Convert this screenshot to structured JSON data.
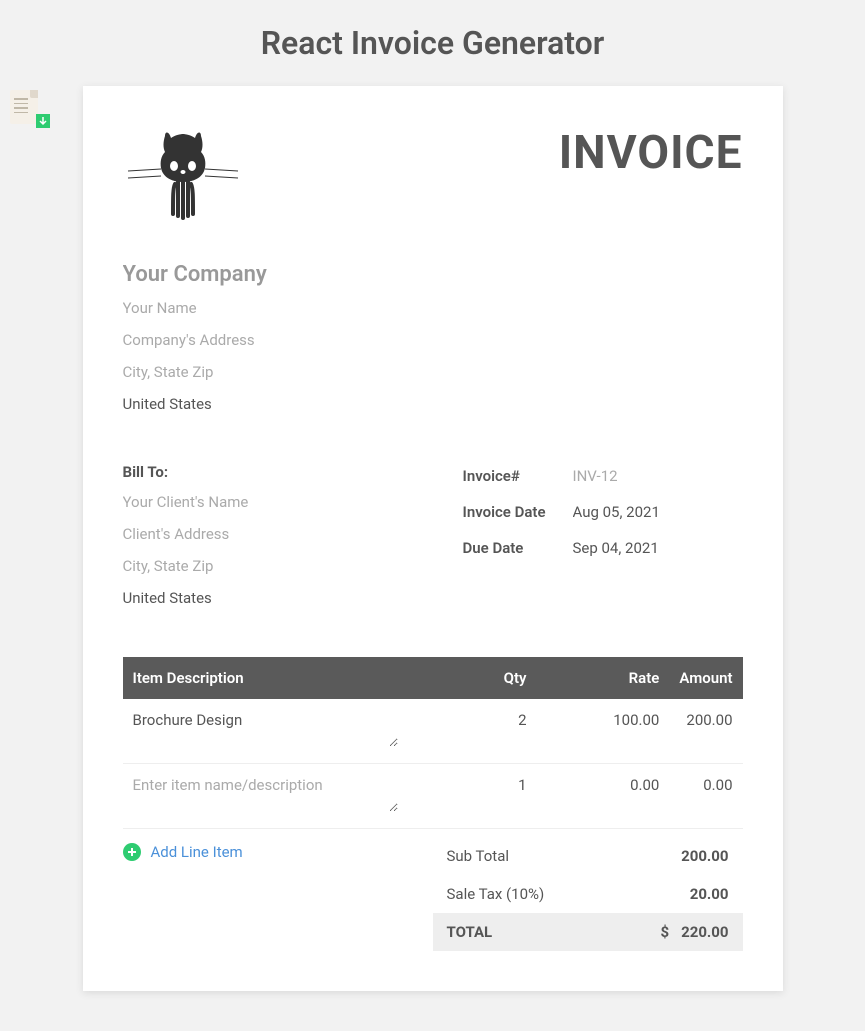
{
  "app_title": "React Invoice Generator",
  "header": {
    "title": "INVOICE"
  },
  "company": {
    "name_placeholder": "Your Company",
    "contact_placeholder": "Your Name",
    "address_placeholder": "Company's Address",
    "city_placeholder": "City, State Zip",
    "country_value": "United States"
  },
  "client": {
    "bill_to_label": "Bill To:",
    "name_placeholder": "Your Client's Name",
    "address_placeholder": "Client's Address",
    "city_placeholder": "City, State Zip",
    "country_value": "United States"
  },
  "meta": {
    "invoice_number_label": "Invoice#",
    "invoice_number_value": "INV-12",
    "invoice_date_label": "Invoice Date",
    "invoice_date_value": "Aug 05, 2021",
    "due_date_label": "Due Date",
    "due_date_value": "Sep 04, 2021"
  },
  "table": {
    "headers": {
      "description": "Item Description",
      "qty": "Qty",
      "rate": "Rate",
      "amount": "Amount"
    },
    "rows": [
      {
        "description": "Brochure Design",
        "qty": "2",
        "rate": "100.00",
        "amount": "200.00"
      },
      {
        "description": "",
        "description_placeholder": "Enter item name/description",
        "qty": "1",
        "rate": "0.00",
        "amount": "0.00"
      }
    ]
  },
  "add_line_label": "Add Line Item",
  "totals": {
    "subtotal_label": "Sub Total",
    "subtotal_value": "200.00",
    "tax_label": "Sale Tax (10%)",
    "tax_value": "20.00",
    "total_label": "TOTAL",
    "currency": "$",
    "total_value": "220.00"
  }
}
